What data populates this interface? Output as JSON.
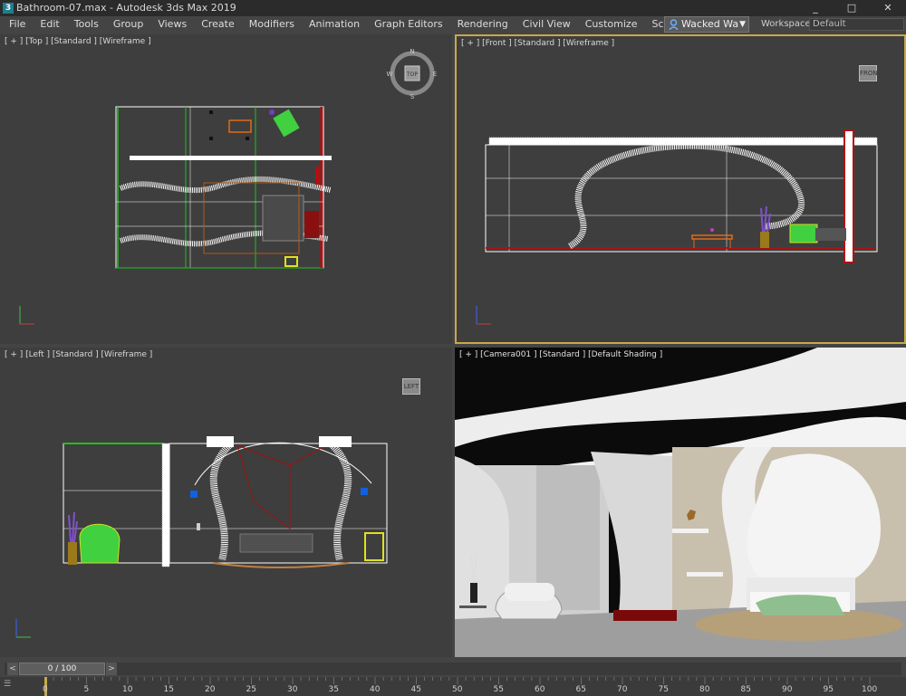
{
  "titlebar": {
    "title": "Bathroom-07.max - Autodesk 3ds Max 2019",
    "icon_name": "3ds-max-logo-icon",
    "min_glyph": "_",
    "max_glyph": "□",
    "close_glyph": "✕"
  },
  "menu": {
    "items": [
      "File",
      "Edit",
      "Tools",
      "Group",
      "Views",
      "Create",
      "Modifiers",
      "Animation",
      "Graph Editors",
      "Rendering",
      "Civil View",
      "Customize",
      "Scripting"
    ],
    "user_label": "Wacked Wa",
    "workspaces_label": "Workspaces:",
    "workspace_value": "Default"
  },
  "viewports": {
    "top_left": {
      "label": "[ + ] [Top ] [Standard ] [Wireframe ]",
      "cube_label": "TOP",
      "compass": {
        "n": "N",
        "s": "S",
        "e": "E",
        "w": "W"
      }
    },
    "top_right": {
      "label": "[ + ] [Front ] [Standard ] [Wireframe ]",
      "cube_label": "FRON"
    },
    "bottom_left": {
      "label": "[ + ] [Left ] [Standard ] [Wireframe ]",
      "cube_label": "LEFT"
    },
    "bottom_right": {
      "label": "[ + ] [Camera001 ] [Standard ] [Default Shading ]"
    }
  },
  "timeline": {
    "frame_display": "0 / 100",
    "ticks": [
      "0",
      "5",
      "10",
      "15",
      "20",
      "25",
      "30",
      "35",
      "40",
      "45",
      "50",
      "55",
      "60",
      "65",
      "70",
      "75",
      "80",
      "85",
      "90",
      "95",
      "100"
    ]
  },
  "colors": {
    "active_viewport_border": "#c9a84a",
    "wire_white": "#ffffff",
    "wire_red": "#a01010",
    "wire_green": "#20a020"
  }
}
